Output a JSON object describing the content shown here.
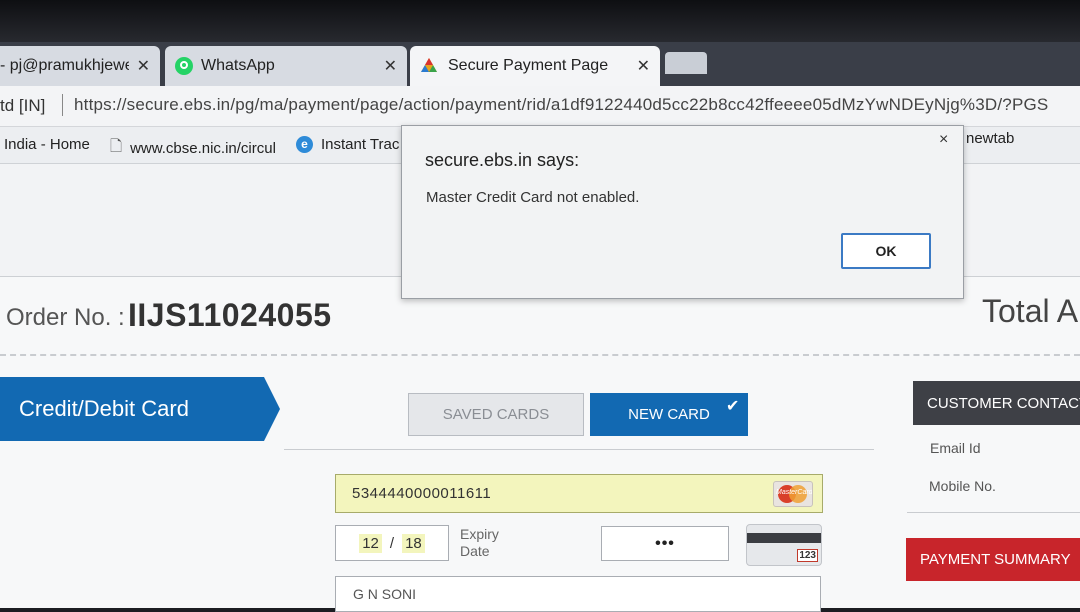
{
  "browser": {
    "tabs": [
      {
        "label": "- pj@pramukhjewe",
        "close": "✕"
      },
      {
        "label": "WhatsApp",
        "close": "✕"
      },
      {
        "label": "Secure Payment Page",
        "close": "✕"
      }
    ],
    "address": {
      "site_badge": "td [IN]",
      "url": "https://secure.ebs.in/pg/ma/payment/page/action/payment/rid/a1df9122440d5cc22b8cc42ffeeee05dMzYwNDEyNjg%3D/?PGS"
    },
    "bookmarks": [
      "India - Home",
      "www.cbse.nic.in/circul",
      "Instant Trac",
      "newtab"
    ]
  },
  "dialog": {
    "title": "secure.ebs.in says:",
    "message": "Master Credit Card not enabled.",
    "ok_label": "OK",
    "close": "×"
  },
  "order": {
    "label": "Order No. :",
    "number": "IIJS11024055",
    "total_label": "Total A"
  },
  "payment_tab": "Credit/Debit Card",
  "card_tabs": {
    "saved": "SAVED CARDS",
    "new": "NEW CARD"
  },
  "form": {
    "card_number": "5344440000011611",
    "card_brand": "MasterCard",
    "expiry_month": "12",
    "expiry_sep": "/",
    "expiry_year": "18",
    "expiry_label_1": "Expiry",
    "expiry_label_2": "Date",
    "cvv_masked": "•••",
    "cvv_icon_text": "123",
    "name": "G N SONI"
  },
  "sidebar": {
    "customer_contact": "CUSTOMER CONTACT",
    "email_label": "Email Id",
    "mobile_label": "Mobile No.",
    "payment_summary": "PAYMENT SUMMARY"
  },
  "colors": {
    "primary_blue": "#1269b2",
    "summary_red": "#c8252b",
    "header_dark": "#3e4046",
    "field_yellow": "#f3f5bd"
  }
}
